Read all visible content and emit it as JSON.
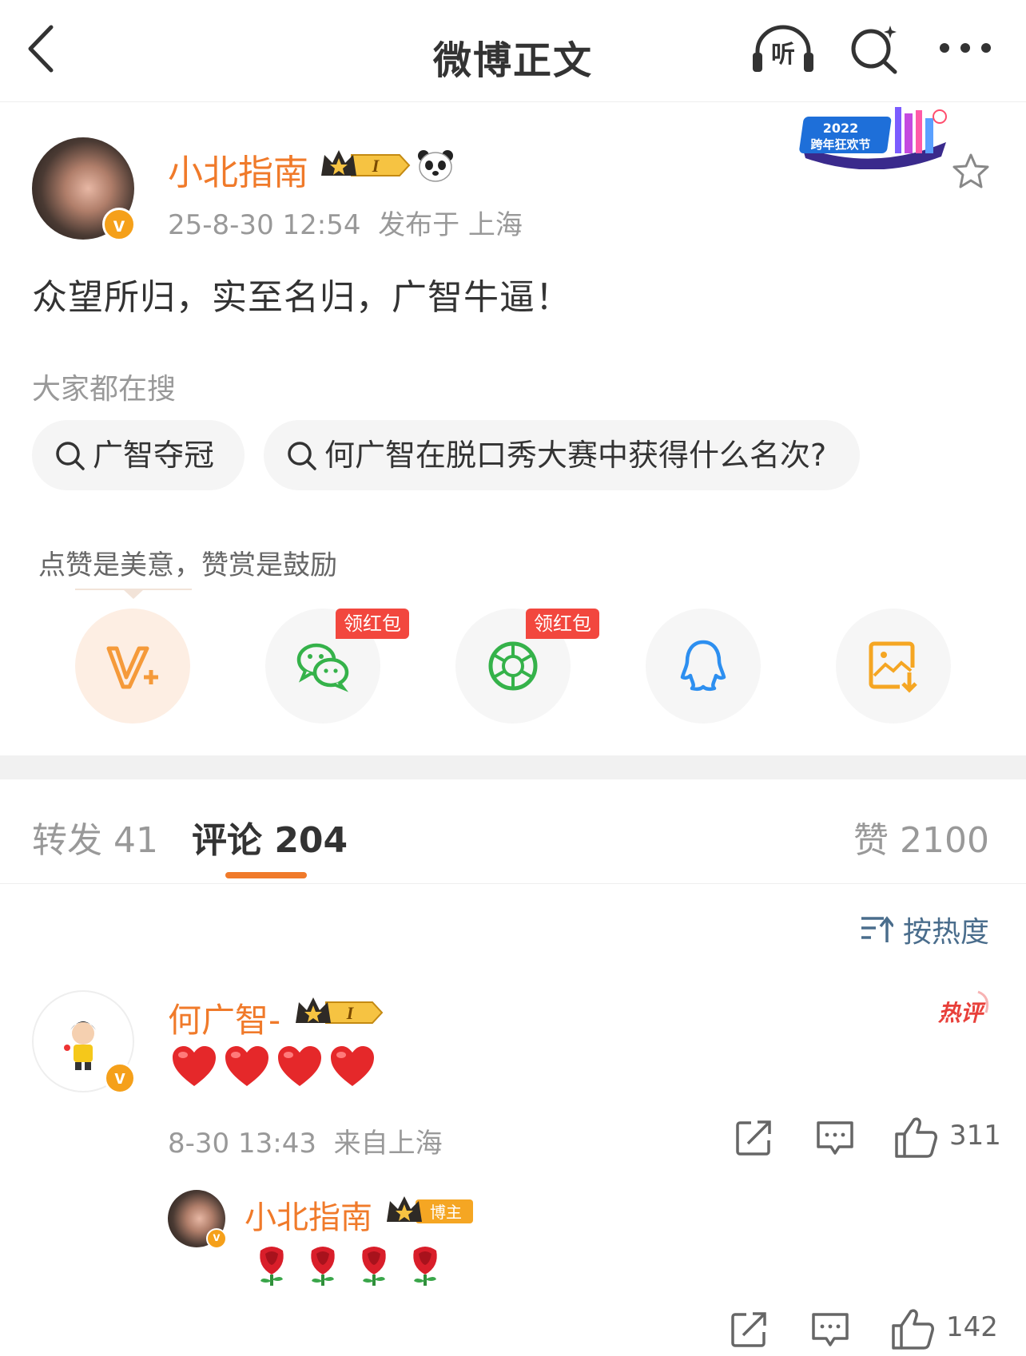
{
  "header": {
    "title": "微博正文",
    "listen_label": "听"
  },
  "post": {
    "username": "小北指南",
    "crown_level": "I",
    "meta": "25-8-30 12:54  发布于 上海",
    "text": "众望所归，实至名归，广智牛逼！",
    "banner_year": "2022",
    "banner_text": "跨年狂欢节"
  },
  "searches": {
    "heading": "大家都在搜",
    "items": [
      "广智夺冠",
      "何广智在脱口秀大赛中获得什么名次?"
    ]
  },
  "reward": {
    "hint": "点赞是美意，赞赏是鼓励",
    "hongbao_label": "领红包"
  },
  "tabs": {
    "repost": "转发 41",
    "comments": "评论 204",
    "likes": "赞 2100"
  },
  "sort": {
    "label": "按热度"
  },
  "comment": {
    "username": "何广智-",
    "crown_level": "I",
    "hot_label": "热评",
    "meta": "8-30 13:43  来自上海",
    "likes": "311"
  },
  "reply": {
    "username": "小北指南",
    "badge": "博主",
    "likes": "142"
  },
  "colors": {
    "accent": "#f07a2a",
    "verified": "#f5a01a",
    "hongbao": "#f2473e",
    "link_blue": "#4a6d8c"
  }
}
